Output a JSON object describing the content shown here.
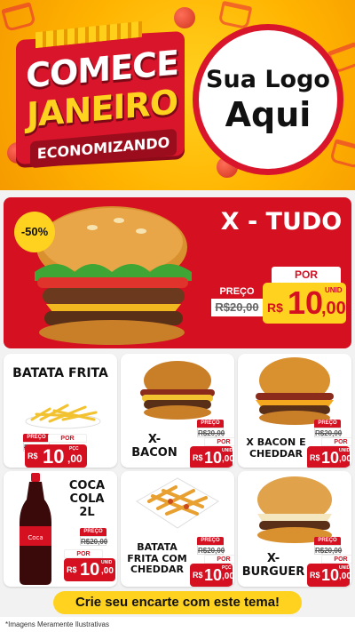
{
  "header": {
    "title_line1": "COMECE",
    "title_line2": "JANEIRO",
    "title_line3": "ECONOMIZANDO",
    "logo_line1": "Sua Logo",
    "logo_line2": "Aqui"
  },
  "featured": {
    "discount": "-50%",
    "name": "X - TUDO",
    "preco_label": "PREÇO",
    "old_price": "R$20,00",
    "por_label": "POR",
    "currency": "R$",
    "price_int": "10",
    "price_cents": ",00",
    "unit": "UNID"
  },
  "products": [
    {
      "name": "BATATA FRITA",
      "preco_label": "PREÇO",
      "old_price": "R$20,00",
      "por_label": "POR",
      "currency": "R$",
      "price_int": "10",
      "price_cents": ",00",
      "unit": "PÇC"
    },
    {
      "name": "X-\nBACON",
      "preco_label": "PREÇO",
      "old_price": "R$20,00",
      "por_label": "POR",
      "currency": "R$",
      "price_int": "10",
      "price_cents": ",00",
      "unit": "UNID"
    },
    {
      "name": "X BACON E\nCHEDDAR",
      "preco_label": "PREÇO",
      "old_price": "R$20,00",
      "por_label": "POR",
      "currency": "R$",
      "price_int": "10",
      "price_cents": ",00",
      "unit": "UNID"
    },
    {
      "name": "COCA\nCOLA\n2L",
      "preco_label": "PREÇO",
      "old_price": "R$20,00",
      "por_label": "POR",
      "currency": "R$",
      "price_int": "10",
      "price_cents": ",00",
      "unit": "UNID"
    },
    {
      "name": "BATATA\nFRITA COM\nCHEDDAR",
      "preco_label": "PREÇO",
      "old_price": "R$20,00",
      "por_label": "POR",
      "currency": "R$",
      "price_int": "10",
      "price_cents": ",00",
      "unit": "PÇC"
    },
    {
      "name": "X-\nBURGUER",
      "preco_label": "PREÇO",
      "old_price": "R$20,00",
      "por_label": "POR",
      "currency": "R$",
      "price_int": "10",
      "price_cents": ",00",
      "unit": "UNID"
    }
  ],
  "cta": "Crie seu encarte com este tema!",
  "footer": "*Imagens Meramente Ilustrativas",
  "colors": {
    "brand_red": "#d41021",
    "brand_yellow": "#ffd21f",
    "header_orange": "#ffb300"
  }
}
